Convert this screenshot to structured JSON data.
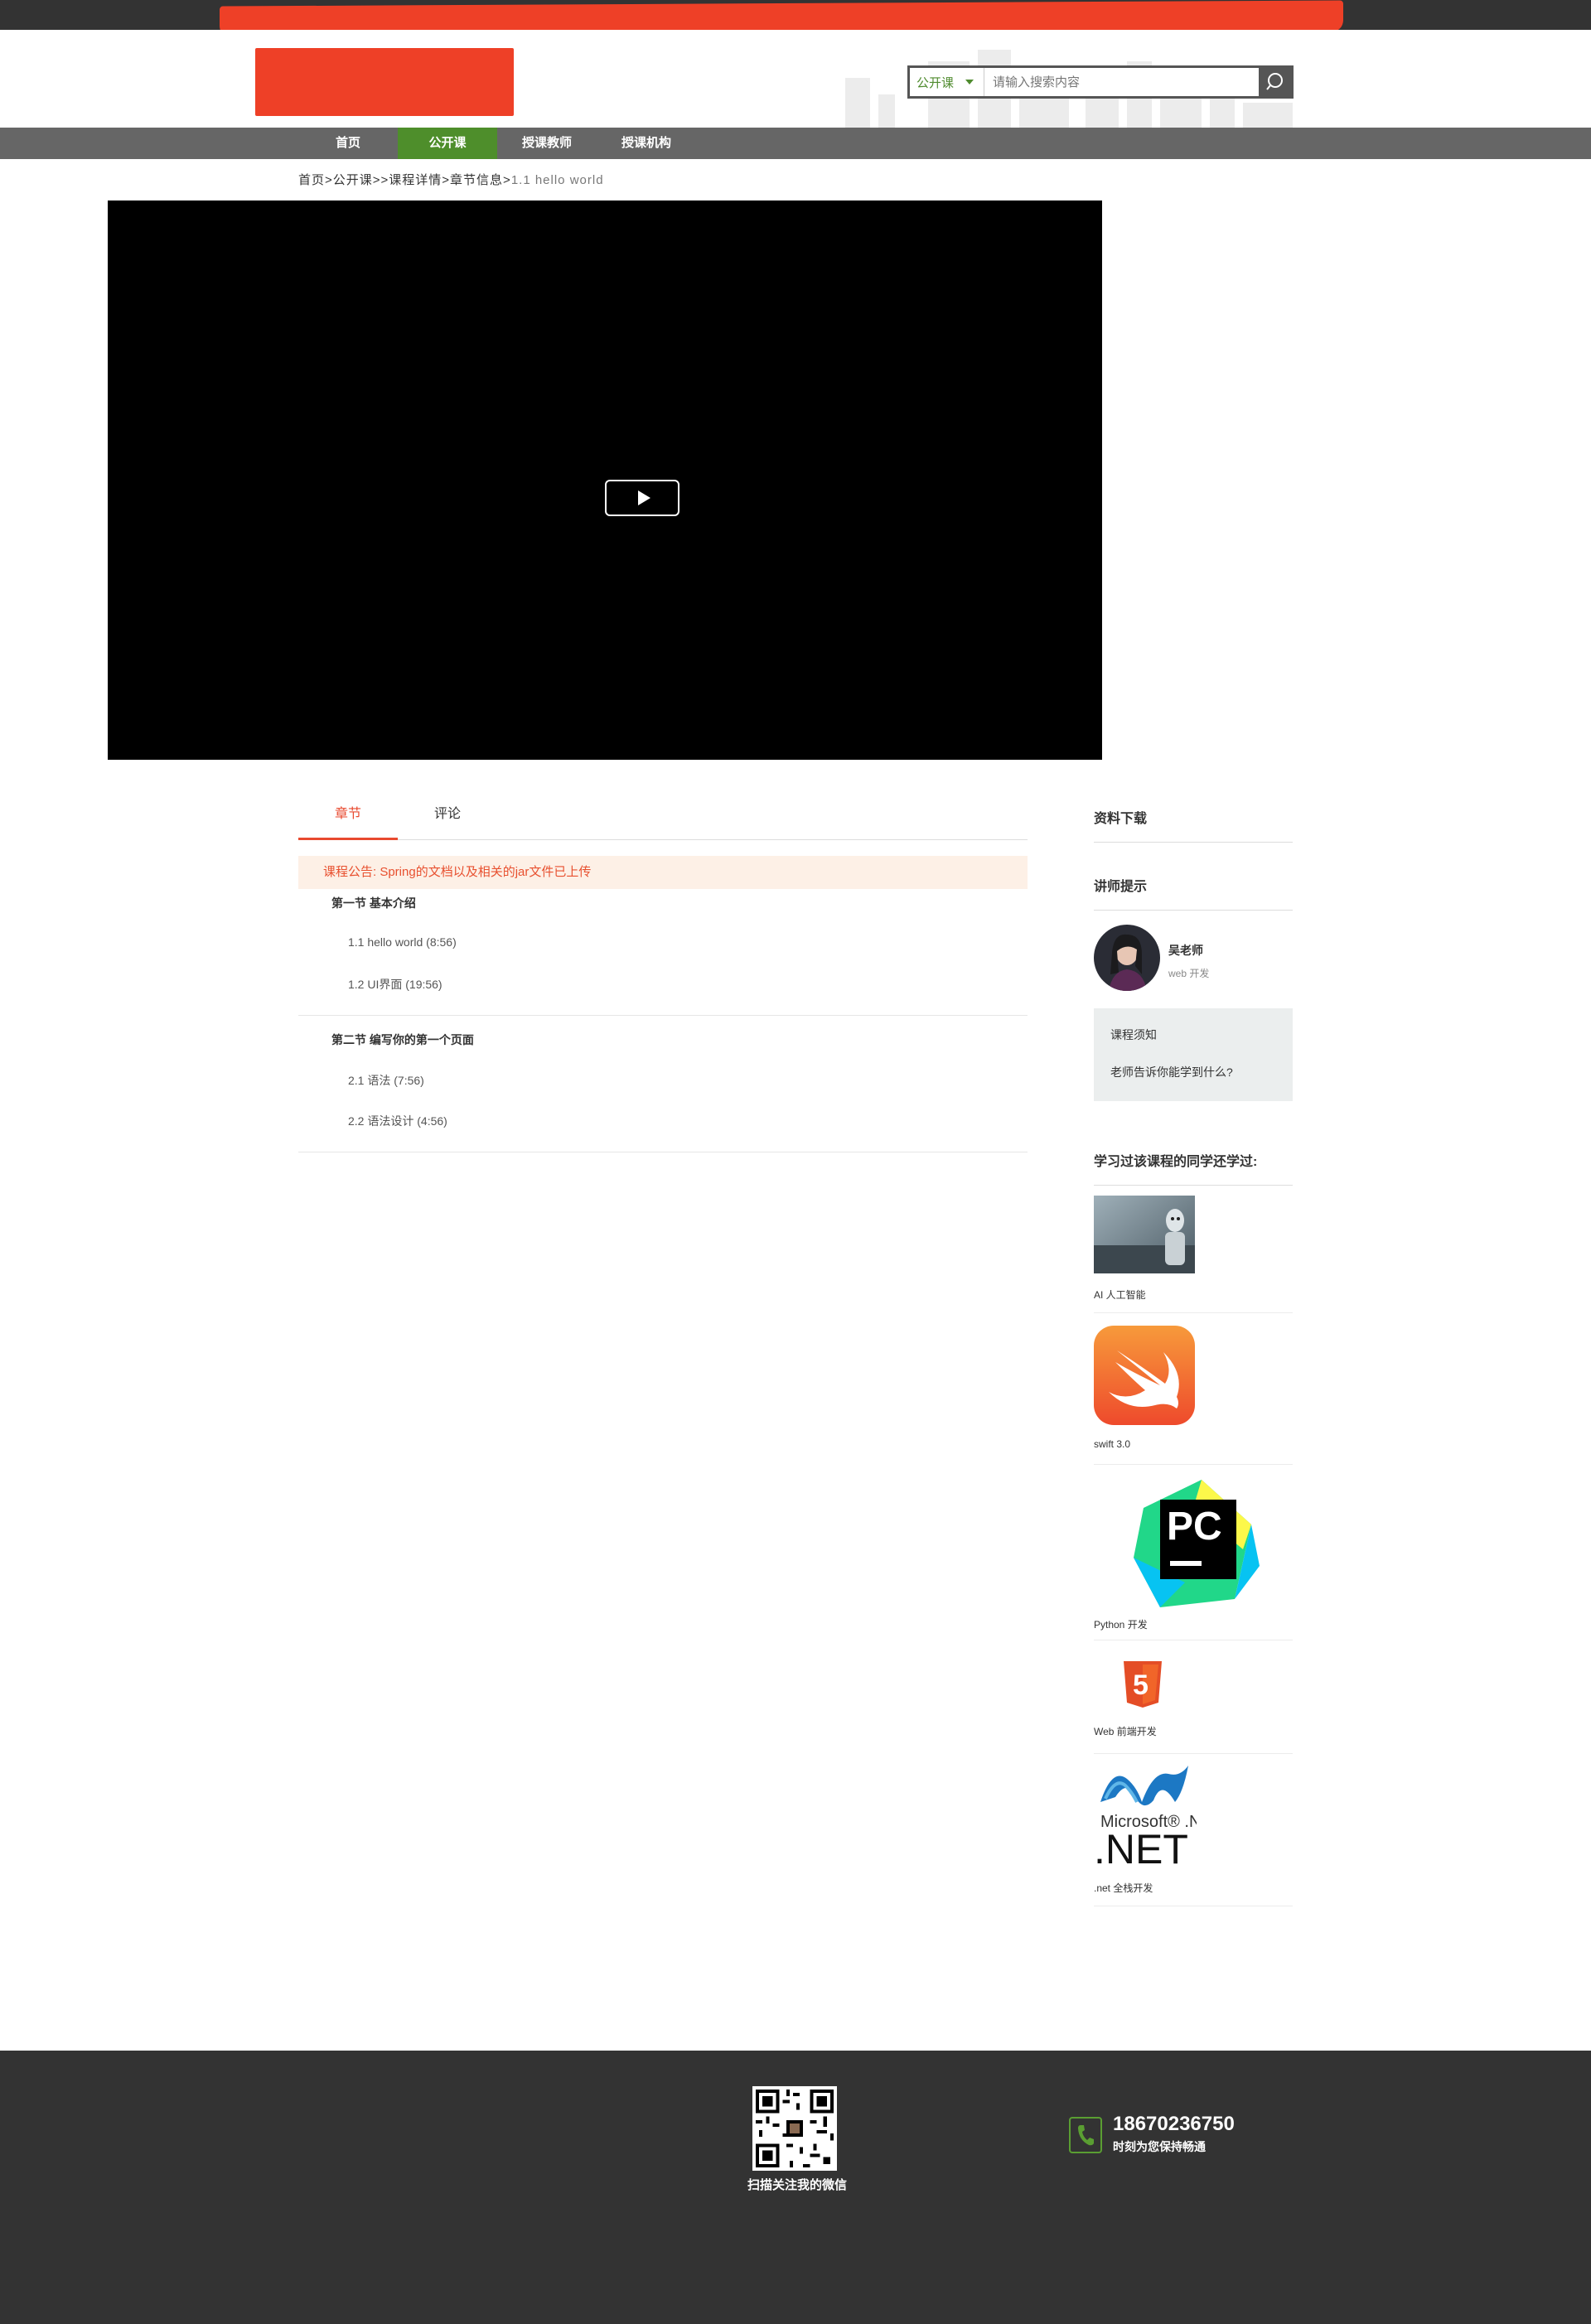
{
  "header": {
    "search": {
      "category": "公开课",
      "placeholder": "请输入搜索内容"
    }
  },
  "nav": {
    "items": [
      {
        "label": "首页"
      },
      {
        "label": "公开课",
        "active": true
      },
      {
        "label": "授课教师"
      },
      {
        "label": "授课机构"
      }
    ]
  },
  "breadcrumb": {
    "path": "首页>公开课>>课程详情>章节信息>",
    "current": "1.1 hello world"
  },
  "tabs": [
    {
      "label": "章节",
      "active": true
    },
    {
      "label": "评论"
    }
  ],
  "notice": "课程公告: Spring的文档以及相关的jar文件已上传",
  "chapters": [
    {
      "title": "第一节 基本介绍",
      "lessons": [
        "1.1 hello world (8:56)",
        "1.2 UI界面 (19:56)"
      ]
    },
    {
      "title": "第二节 编写你的第一个页面",
      "lessons": [
        "2.1 语法 (7:56)",
        "2.2 语法设计 (4:56)"
      ]
    }
  ],
  "sidebar": {
    "downloads_title": "资料下载",
    "teacher_title": "讲师提示",
    "teacher": {
      "name": "吴老师",
      "role": "web 开发"
    },
    "tips": {
      "item1": "课程须知",
      "item2": "老师告诉你能学到什么?"
    },
    "related_title": "学习过该课程的同学还学过:",
    "related": [
      {
        "caption": "AI 人工智能",
        "icon": "robot-image"
      },
      {
        "caption": "swift 3.0",
        "icon": "swift-logo"
      },
      {
        "caption": "Python 开发",
        "icon": "pycharm-logo",
        "logo_text": "PC"
      },
      {
        "caption": "Web 前端开发",
        "icon": "html5-logo",
        "logo_text": "5"
      },
      {
        "caption": ".net 全栈开发",
        "icon": "dotnet-logo",
        "logo_text": "Microsoft® .NET"
      }
    ]
  },
  "footer": {
    "qr_caption": "扫描关注我的微信",
    "phone": "18670236750",
    "phone_note": "时刻为您保持畅通"
  },
  "colors": {
    "accent_green": "#4e8e2b",
    "accent_red": "#e84a2f",
    "nav_bg": "#666666",
    "footer_bg": "#333333"
  }
}
